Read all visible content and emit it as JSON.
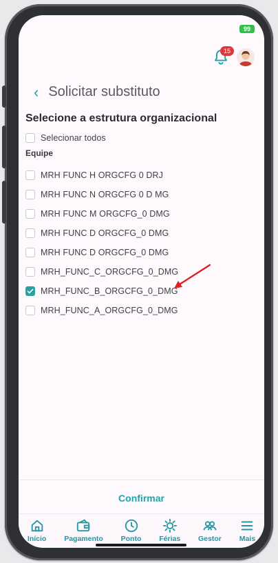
{
  "status": {
    "battery": "99"
  },
  "notifications": {
    "count": "15"
  },
  "header": {
    "back_icon": "‹",
    "title": "Solicitar substituto"
  },
  "section": {
    "title": "Selecione a estrutura organizacional"
  },
  "select_all": {
    "label": "Selecionar todos",
    "checked": false
  },
  "group": {
    "label": "Equipe"
  },
  "items": [
    {
      "label": "MRH FUNC H ORGCFG 0 DRJ",
      "checked": false
    },
    {
      "label": "MRH FUNC N ORGCFG 0 D MG",
      "checked": false
    },
    {
      "label": "MRH FUNC M ORGCFG_0 DMG",
      "checked": false
    },
    {
      "label": "MRH FUNC D ORGCFG_0 DMG",
      "checked": false
    },
    {
      "label": "MRH FUNC D ORGCFG_0 DMG",
      "checked": false
    },
    {
      "label": "MRH_FUNC_C_ORGCFG_0_DMG",
      "checked": false
    },
    {
      "label": "MRH_FUNC_B_ORGCFG_0_DMG",
      "checked": true
    },
    {
      "label": "MRH_FUNC_A_ORGCFG_0_DMG",
      "checked": false
    }
  ],
  "footer": {
    "confirm_label": "Confirmar"
  },
  "nav": [
    {
      "label": "Início",
      "icon": "home-icon"
    },
    {
      "label": "Pagamento",
      "icon": "wallet-icon"
    },
    {
      "label": "Ponto",
      "icon": "clock-icon"
    },
    {
      "label": "Férias",
      "icon": "sun-icon"
    },
    {
      "label": "Gestor",
      "icon": "team-icon"
    },
    {
      "label": "Mais",
      "icon": "menu-icon"
    }
  ],
  "colors": {
    "accent": "#20a4a8",
    "checked": "#2b9fa5",
    "badge": "#e0373c",
    "annotation_arrow": "#e02020"
  }
}
